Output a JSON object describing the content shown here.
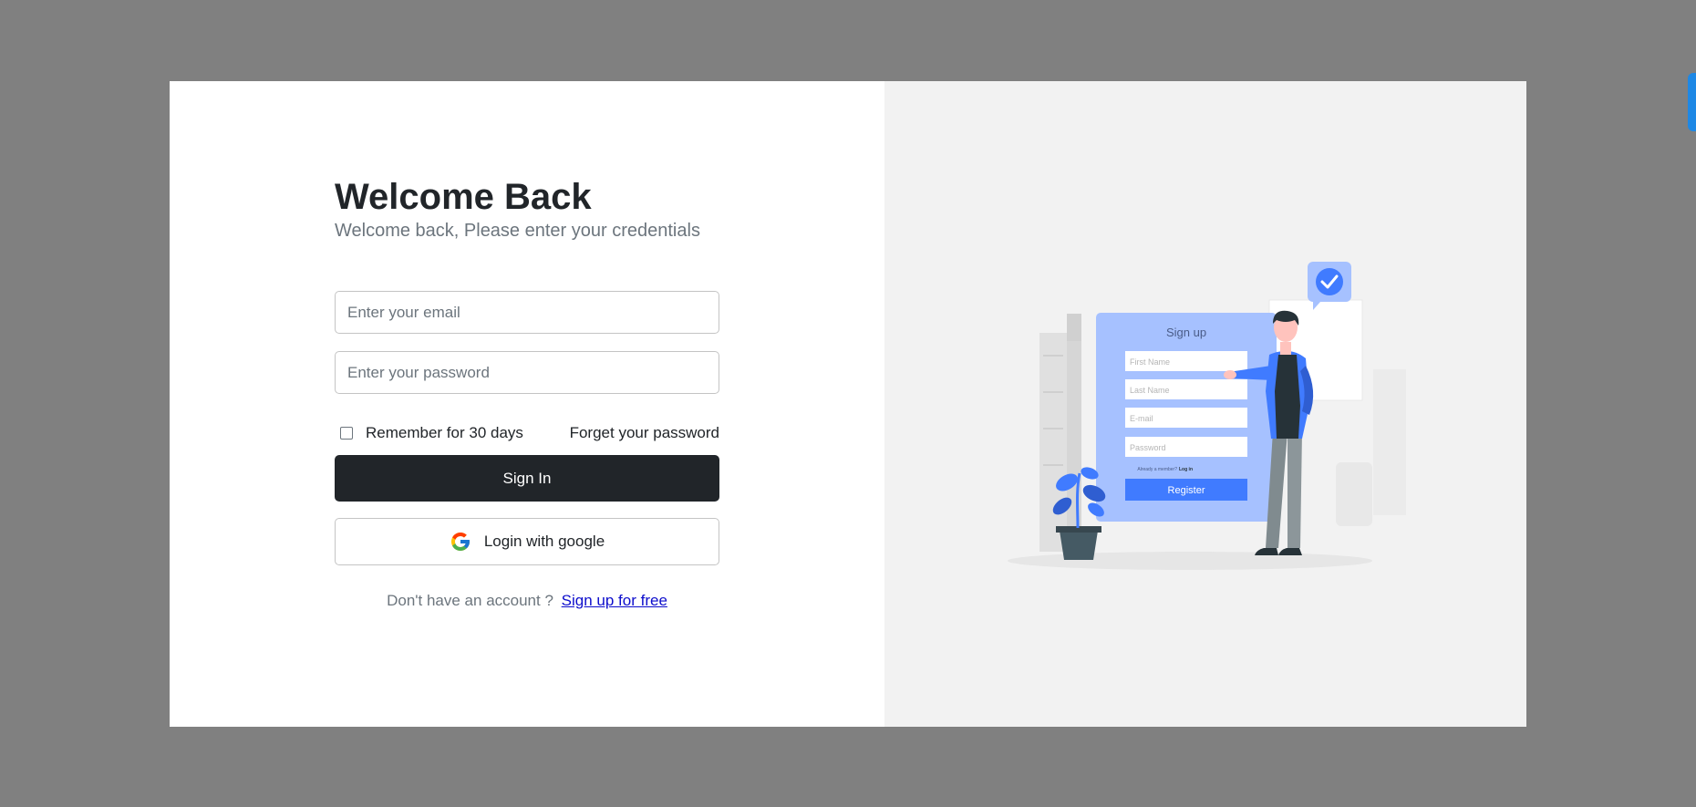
{
  "login": {
    "title": "Welcome Back",
    "subtitle": "Welcome back, Please enter your credentials",
    "email_placeholder": "Enter your email",
    "password_placeholder": "Enter your password",
    "remember_label": "Remember for 30 days",
    "remember_checked": false,
    "forget_label": "Forget your password",
    "signin_label": "Sign In",
    "google_label": "Login with google",
    "google_icon": "google-g-icon",
    "no_account_text": "Don't have an account ?",
    "signup_link": "Sign up for free"
  },
  "illustration": {
    "form_title": "Sign up",
    "fields": [
      "First Name",
      "Last Name",
      "E-mail",
      "Password"
    ],
    "already_text": "Already a member?",
    "login_text": "Log in",
    "register_label": "Register",
    "check_icon": "check-bubble-icon",
    "accent_color": "#407BFF"
  },
  "colors": {
    "backdrop": "#808080",
    "primary_button": "#212529",
    "right_panel": "#f2f2f2",
    "side_tab": "#1e88e5"
  }
}
